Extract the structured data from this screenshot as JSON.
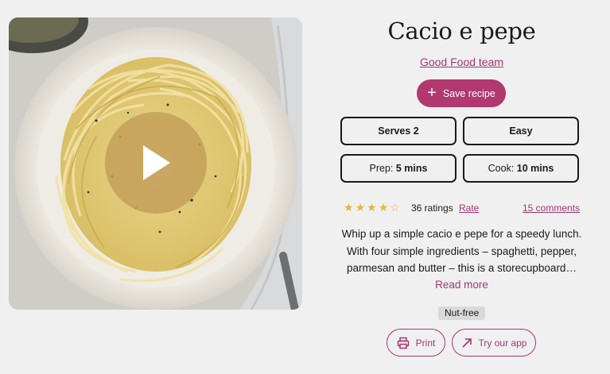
{
  "recipe": {
    "title": "Cacio e pepe",
    "author": "Good Food team",
    "save_label": "Save recipe",
    "serves": "Serves 2",
    "difficulty": "Easy",
    "prep_label": "Prep:",
    "prep_value": "5 mins",
    "cook_label": "Cook:",
    "cook_value": "10 mins",
    "rating_stars": 4,
    "rating_max": 5,
    "ratings_count": "36 ratings",
    "rate_label": "Rate",
    "comments_label": "15 comments",
    "description_lines": [
      "Whip up a simple cacio e pepe for a speedy lunch.",
      "With four simple ingredients – spaghetti, pepper,",
      "parmesan and butter – this is a storecupboard…"
    ],
    "read_more_label": "Read more",
    "tag": "Nut-free",
    "print_label": "Print",
    "app_label": "Try our app"
  },
  "colors": {
    "accent": "#b23870",
    "link": "#a23772",
    "star": "#e8b53a",
    "play": "#c4a05a",
    "background": "#f0f0f0"
  },
  "icons": {
    "play": "play-icon",
    "plus": "plus-icon",
    "star": "star-icon",
    "print": "printer-icon",
    "app": "arrow-up-right-icon"
  }
}
